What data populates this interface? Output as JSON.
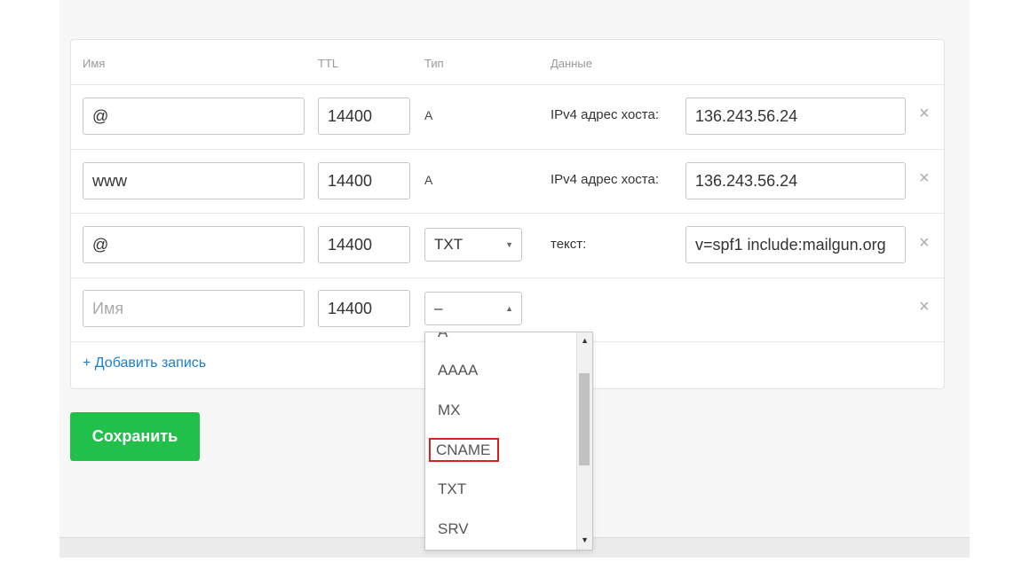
{
  "table": {
    "headers": {
      "name": "Имя",
      "ttl": "TTL",
      "type": "Тип",
      "data": "Данные"
    },
    "rows": [
      {
        "name": "@",
        "ttl": "14400",
        "type": "A",
        "data_label": "IPv4 адрес хоста:",
        "data_value": "136.243.56.24",
        "remove": "×"
      },
      {
        "name": "www",
        "ttl": "14400",
        "type": "A",
        "data_label": "IPv4 адрес хоста:",
        "data_value": "136.243.56.24",
        "remove": "×"
      },
      {
        "name": "@",
        "ttl": "14400",
        "type": "TXT",
        "data_label": "текст:",
        "data_value": "v=spf1 include:mailgun.org",
        "remove": "×"
      },
      {
        "name_placeholder": "Имя",
        "ttl": "14400",
        "type": "–",
        "remove": "×"
      }
    ],
    "add_record": "+ Добавить запись"
  },
  "save_button": "Сохранить",
  "type_dropdown": {
    "partial_top": "A",
    "options": [
      "AAAA",
      "MX",
      "CNAME",
      "TXT",
      "SRV"
    ],
    "highlighted": "CNAME"
  },
  "colors": {
    "save_bg": "#21c04a",
    "link": "#1a7fd4",
    "highlight_outline": "#e02020"
  },
  "icons": {
    "remove": "close-icon",
    "select_down": "chevron-down-icon",
    "select_up": "chevron-up-icon"
  }
}
